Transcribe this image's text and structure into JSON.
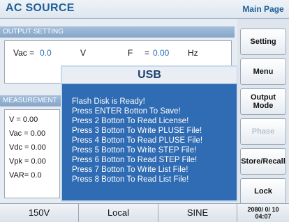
{
  "app": {
    "title": "AC SOURCE",
    "page_title": "Main Page"
  },
  "output_setting": {
    "header": "OUTPUT SETTING",
    "vac_label": "Vac =",
    "vac_value": "0.0",
    "vac_unit": "V",
    "f_label": "F",
    "f_eq": "=",
    "f_value": "0.00",
    "f_unit": "Hz"
  },
  "measurement": {
    "header": "MEASUREMENT",
    "rows": [
      "V    = 0.00",
      "Vac = 0.00",
      "Vdc = 0.00",
      "Vpk = 0.00",
      "VAR= 0.0"
    ]
  },
  "usb_dialog": {
    "title": "USB",
    "lines": [
      "Flash Disk is Ready!",
      "Press ENTER Botton To Save!",
      "Press 2 Botton To Read License!",
      "Press 3 Botton To Write PLUSE File!",
      "Press 4 Botton To Read PLUSE File!",
      "Press 5 Botton To Write STEP File!",
      "Press 6 Botton To Read STEP File!",
      "Press 7 Botton To Write List File!",
      "Press 8 Botton To Read List File!"
    ]
  },
  "sidebar": {
    "setting": "Setting",
    "menu": "Menu",
    "output_mode": "Output Mode",
    "phase": "Phase",
    "store_recall": "Store/Recall",
    "lock": "Lock"
  },
  "status": {
    "range": "150V",
    "control": "Local",
    "waveform": "SINE",
    "date": "2080/ 0/ 10",
    "time": "04:07"
  }
}
